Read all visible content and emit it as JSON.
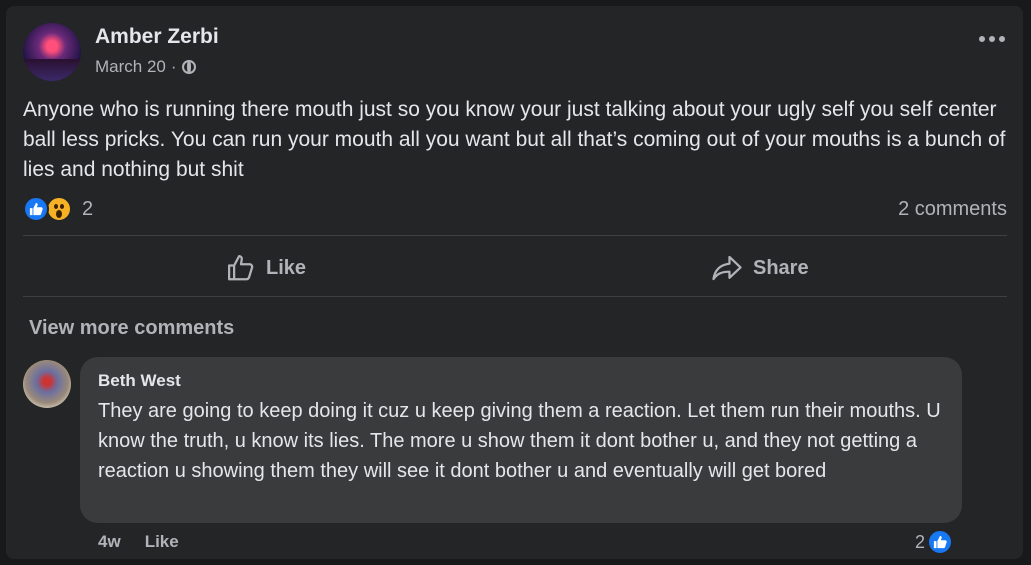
{
  "post": {
    "author": "Amber Zerbi",
    "date": "March 20",
    "separator": "·",
    "text": "Anyone who is running there mouth just so you know your just talking about your ugly self you self center ball less pricks.  You can run your mouth all you want but all that’s coming out of your mouths is a bunch of lies and nothing but shit",
    "reaction_count": "2",
    "comments_label": "2 comments",
    "icons": {
      "more": "more-options-icon",
      "privacy": "globe-icon"
    }
  },
  "actions": {
    "like_label": "Like",
    "share_label": "Share"
  },
  "comments": {
    "view_more_label": "View more comments",
    "items": [
      {
        "author": "Beth West",
        "text": "They are going to keep doing it cuz u keep giving them a reaction. Let them run their mouths. U know the truth, u know its lies. The more u show them it dont bother u, and they not getting a reaction u showing them they will see it dont bother u and eventually will get bored",
        "age": "4w",
        "like_label": "Like",
        "reaction_count": "2"
      }
    ]
  },
  "colors": {
    "background": "#18191a",
    "card": "#242526",
    "bubble": "#3a3b3c",
    "accent": "#1877f2",
    "text": "#e4e6eb",
    "muted": "#b0b3b8"
  }
}
